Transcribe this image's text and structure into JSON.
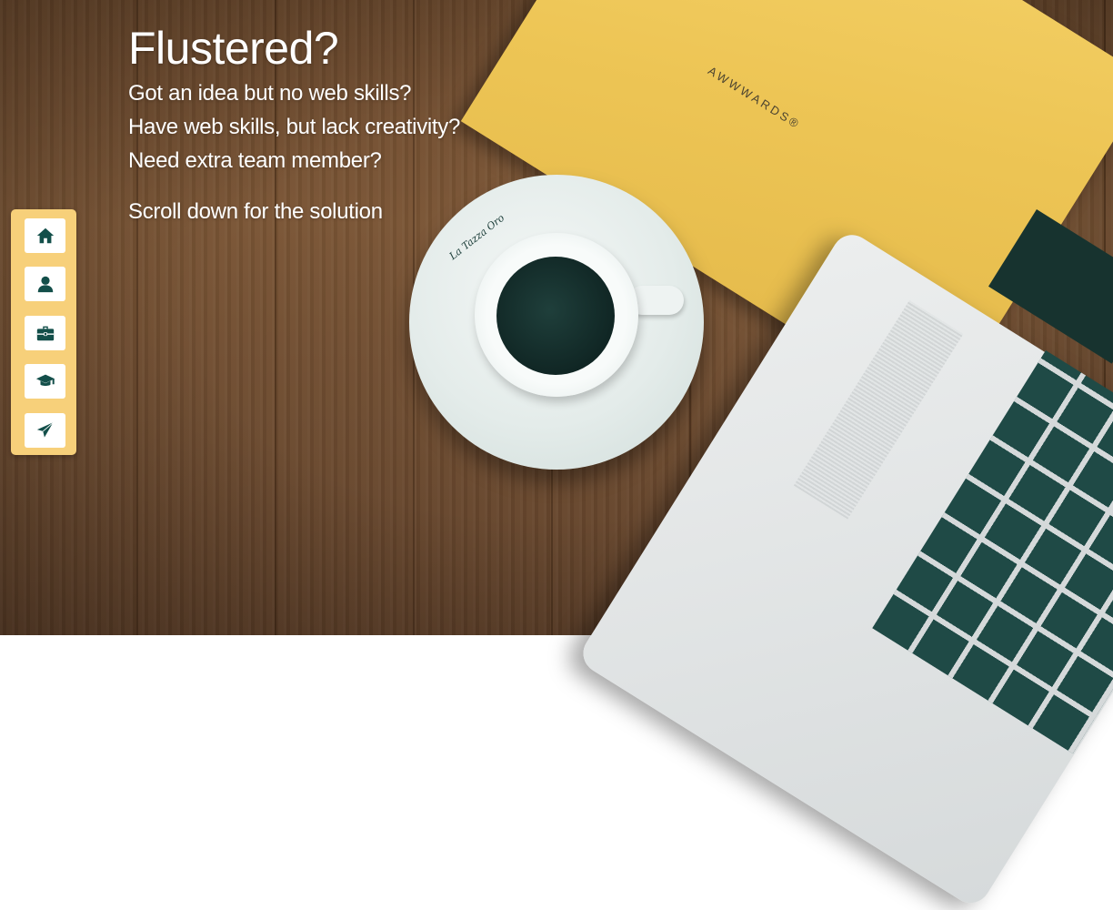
{
  "hero": {
    "title": "Flustered?",
    "lines": [
      "Got an idea but no web skills?",
      "Have web skills, but lack creativity?",
      "Need extra team member?"
    ],
    "cta": "Scroll down for the solution"
  },
  "decor": {
    "notebook_brand": "AWWWARDS®",
    "cup_logo": "La Tazza Oro"
  },
  "sidenav": {
    "items": [
      {
        "icon": "home-icon"
      },
      {
        "icon": "user-icon"
      },
      {
        "icon": "briefcase-icon"
      },
      {
        "icon": "graduation-cap-icon"
      },
      {
        "icon": "paper-plane-icon"
      }
    ]
  },
  "colors": {
    "nav_background": "#f7d07a",
    "icon_color": "#134f4a",
    "text": "#ffffff"
  }
}
